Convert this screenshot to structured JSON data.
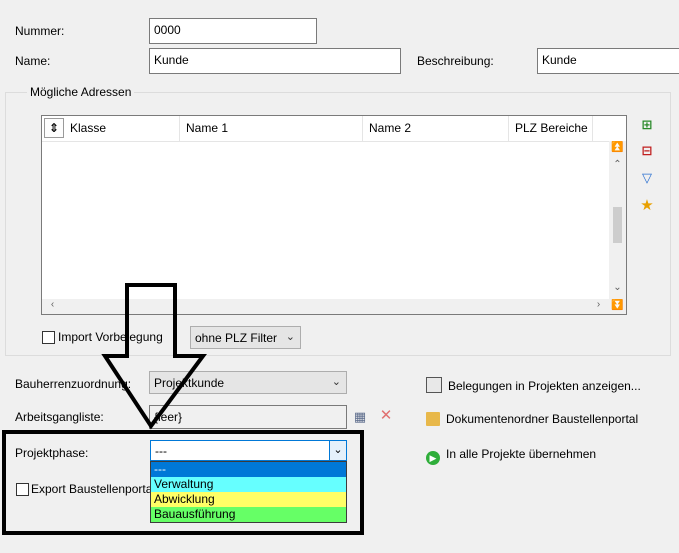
{
  "form": {
    "nummer_label": "Nummer:",
    "nummer_value": "0000",
    "name_label": "Name:",
    "name_value": "Kunde",
    "beschreibung_label": "Beschreibung:",
    "beschreibung_value": "Kunde"
  },
  "addresses": {
    "group_title": "Mögliche Adressen",
    "columns": [
      "Klasse",
      "Name 1",
      "Name 2",
      "PLZ Bereiche"
    ],
    "import_label": "Import Vorbelegung",
    "import_checked": false,
    "plz_filter_value": "ohne PLZ Filter",
    "side_icons": [
      "add-row-icon",
      "remove-row-icon",
      "filter-icon",
      "star-icon"
    ]
  },
  "bauherr": {
    "label": "Bauherrenzuordnung:",
    "value": "Projektkunde"
  },
  "arbeitsgang": {
    "label": "Arbeitsgangliste:",
    "value": "{leer}"
  },
  "projektphase": {
    "label": "Projektphase:",
    "value": "---",
    "options": [
      {
        "label": "---",
        "color": "#0078d7",
        "selected": true
      },
      {
        "label": "Verwaltung",
        "color": "#66ffff",
        "selected": false
      },
      {
        "label": "Abwicklung",
        "color": "#ffff66",
        "selected": false
      },
      {
        "label": "Bauausführung",
        "color": "#66ff66",
        "selected": false
      }
    ]
  },
  "export": {
    "label": "Export Baustellenportal",
    "checked": false
  },
  "actions": {
    "belegungen": "Belegungen in Projekten anzeigen...",
    "dokumentenordner": "Dokumentenordner Baustellenportal",
    "alle_projekte": "In alle Projekte übernehmen"
  }
}
